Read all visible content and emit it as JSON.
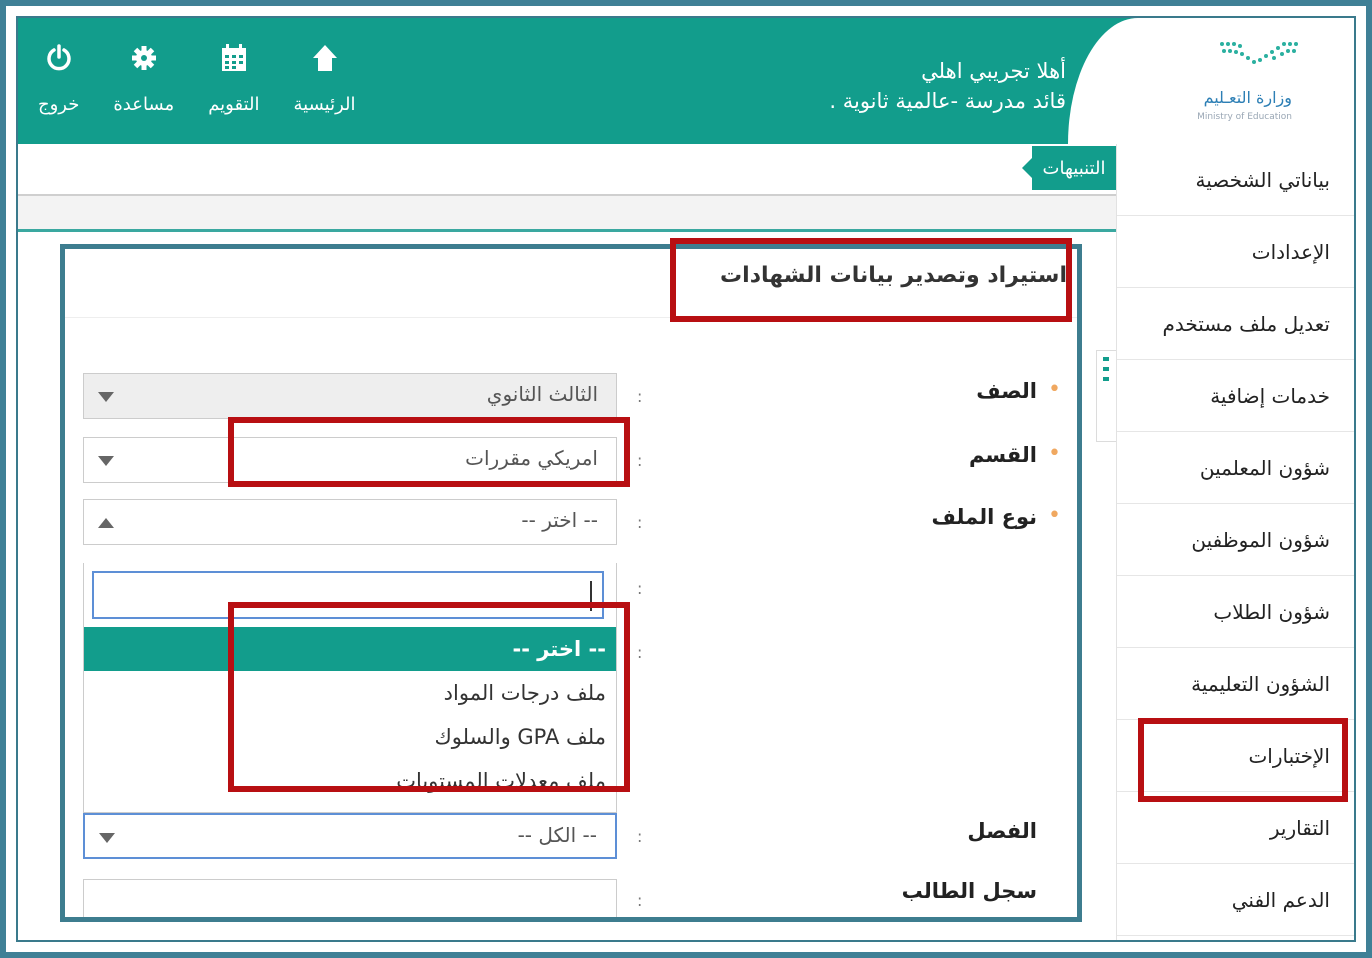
{
  "header": {
    "welcome_line1": "أهلا تجريبي اهلي",
    "welcome_line2": "قائد مدرسة -عالمية ثانوية .",
    "logo_text": "وزارة التعـليم",
    "logo_sub": "Ministry of Education",
    "nav": [
      {
        "label": "الرئيسية",
        "icon": "home-icon"
      },
      {
        "label": "التقويم",
        "icon": "calendar-icon"
      },
      {
        "label": "مساعدة",
        "icon": "gear-icon"
      },
      {
        "label": "خروج",
        "icon": "power-icon"
      }
    ],
    "band_color": "#129d8c"
  },
  "alerts": {
    "label": "التنبيهات"
  },
  "sidebar": {
    "items": [
      {
        "label": "بياناتي الشخصية"
      },
      {
        "label": "الإعدادات"
      },
      {
        "label": "تعديل ملف مستخدم"
      },
      {
        "label": "خدمات إضافية"
      },
      {
        "label": "شؤون المعلمين"
      },
      {
        "label": "شؤون الموظفين"
      },
      {
        "label": "شؤون الطلاب"
      },
      {
        "label": "الشؤون التعليمية"
      },
      {
        "label": "الإختبارات"
      },
      {
        "label": "التقارير"
      },
      {
        "label": "الدعم الفني"
      }
    ]
  },
  "form": {
    "title": "استيراد وتصدير بيانات الشهادات",
    "colon": ":",
    "star": "•",
    "grade": {
      "label": "الصف",
      "value": "الثالث الثانوي"
    },
    "section": {
      "label": "القسم",
      "value": "امريكي مقررات"
    },
    "file_type": {
      "label": "نوع الملف",
      "value": "-- اختر --"
    },
    "file_type_options": [
      {
        "label": "-- اختر --",
        "selected": true
      },
      {
        "label": "ملف درجات المواد",
        "selected": false
      },
      {
        "label": "ملف GPA والسلوك",
        "selected": false
      },
      {
        "label": "ملف معدلات المستويات",
        "selected": false
      }
    ],
    "semester": {
      "label": "الفصل",
      "value": "-- الكل --"
    },
    "student_record": {
      "label": "سجل الطالب",
      "value": ""
    }
  },
  "highlight_color": "#b80f12"
}
